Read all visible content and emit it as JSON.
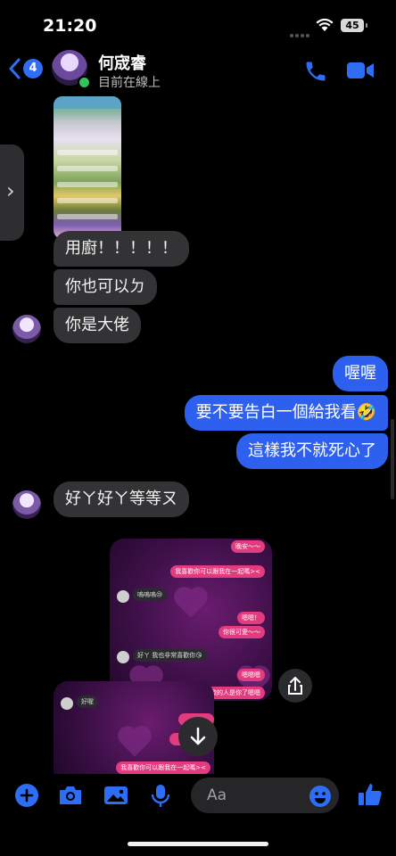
{
  "status_bar": {
    "time": "21:20",
    "battery": "45"
  },
  "header": {
    "back_badge": "4",
    "contact_name": "何宬睿",
    "presence": "目前在線上"
  },
  "messages": [
    {
      "sender": "contact",
      "text": "用廚！！！！！"
    },
    {
      "sender": "contact",
      "text": "你也可以ㄉ"
    },
    {
      "sender": "contact",
      "text": "你是大佬"
    },
    {
      "sender": "me",
      "text": "喔喔"
    },
    {
      "sender": "me",
      "text": "要不要告白一個給我看🤣"
    },
    {
      "sender": "me",
      "text": "這樣我不就死心了"
    },
    {
      "sender": "contact",
      "text": "好ㄚ好ㄚ等等ㄡ"
    }
  ],
  "shared_screenshot_1": {
    "bubbles": [
      {
        "text": "晚安～～",
        "style": "pink"
      },
      {
        "text": "我喜歡你可以跟我在一起嗎><",
        "style": "pink"
      },
      {
        "text": "嗚嗚嗚😢",
        "style": "gray"
      },
      {
        "text": "嗯嗯！",
        "style": "pink"
      },
      {
        "text": "你很可愛～～",
        "style": "pink"
      },
      {
        "text": "好ㄚ 我也非常喜歡你😘",
        "style": "gray"
      },
      {
        "text": "嗯嗯嗯",
        "style": "pink"
      },
      {
        "text": "喜歡的人是你了嗯嗯",
        "style": "pink"
      }
    ]
  },
  "shared_screenshot_2": {
    "bubbles": [
      {
        "text": "好喔",
        "style": "gray"
      },
      {
        "text": "我喜歡你可以跟我在一起嗎><",
        "style": "pink"
      }
    ]
  },
  "composer": {
    "placeholder": "Aa"
  },
  "colors": {
    "accent": "#2e60f0",
    "incoming_bubble": "#333335",
    "background": "#000000"
  }
}
